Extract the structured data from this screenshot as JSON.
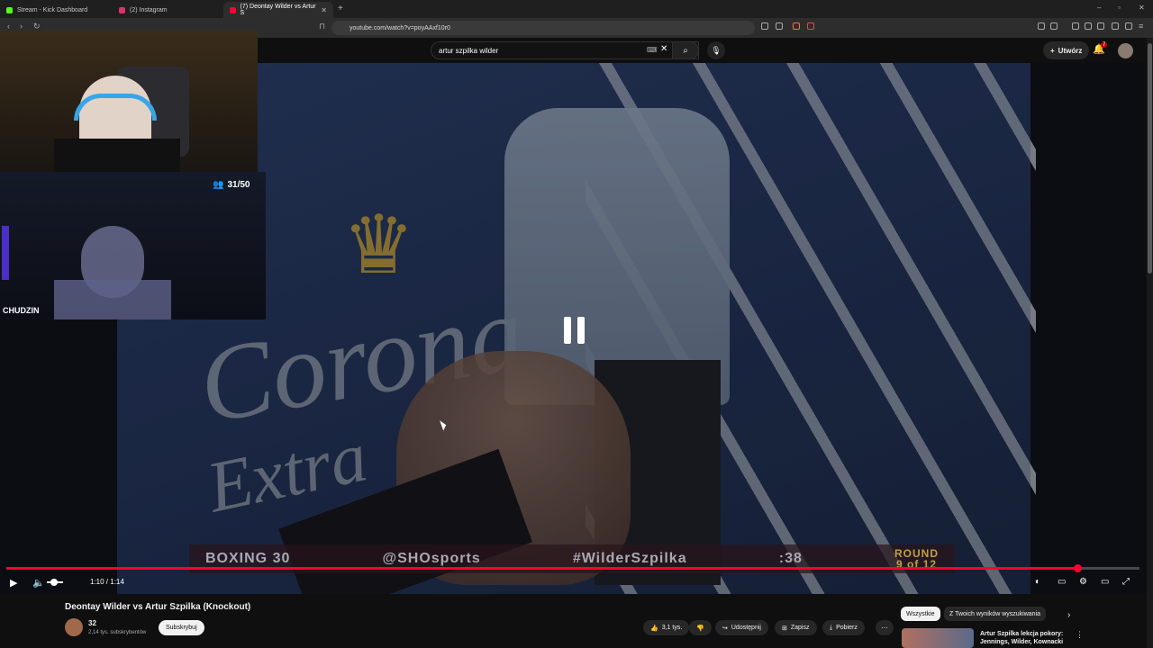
{
  "browser": {
    "tabs": [
      {
        "title": "Stream - Kick Dashboard",
        "favicon_color": "#53fc18",
        "active": false
      },
      {
        "title": "(2) Instagram",
        "favicon_color": "#e1306c",
        "active": false
      },
      {
        "title": "(7) Deontay Wilder vs Artur S",
        "favicon_color": "#ff0033",
        "active": true
      }
    ],
    "new_tab": "+",
    "url": "youtube.com/watch?v=poyAAxf10r0"
  },
  "youtube": {
    "search_query": "artur szpilka wilder",
    "create_label": "Utwórz",
    "notification_count": "7"
  },
  "video": {
    "lower_third": {
      "left": "BOXING 30",
      "handle": "@SHOsports",
      "hashtag": "#WilderSzpilka",
      "clock": ":38",
      "round_line1": "ROUND",
      "round_line2": "9 of 12"
    },
    "backdrop_text_1": "Corona",
    "backdrop_text_2": "Extra"
  },
  "player": {
    "time": "1:10 / 1:14",
    "progress_fraction": 0.945,
    "volume_fraction": 0.45
  },
  "overlay": {
    "viewers": "31/50",
    "streamer_name": "CHUDZIN"
  },
  "details": {
    "title": "Deontay Wilder vs Artur Szpilka (Knockout)",
    "channel_name": "32",
    "subscribers": "2,14 tys. subskrybentów",
    "subscribe": "Subskrybuj",
    "likes": "3,1 tys.",
    "share": "Udostępnij",
    "save": "Zapisz",
    "download": "Pobierz"
  },
  "recommendations": {
    "chips": [
      "Wszystkie",
      "Z Twoich wyników wyszukiwania"
    ],
    "first_title": "Artur Szpilka lekcja pokory: Jennings, Wilder, Kownacki"
  },
  "colors": {
    "accent": "#ff0033",
    "background": "#0f0f0f"
  }
}
